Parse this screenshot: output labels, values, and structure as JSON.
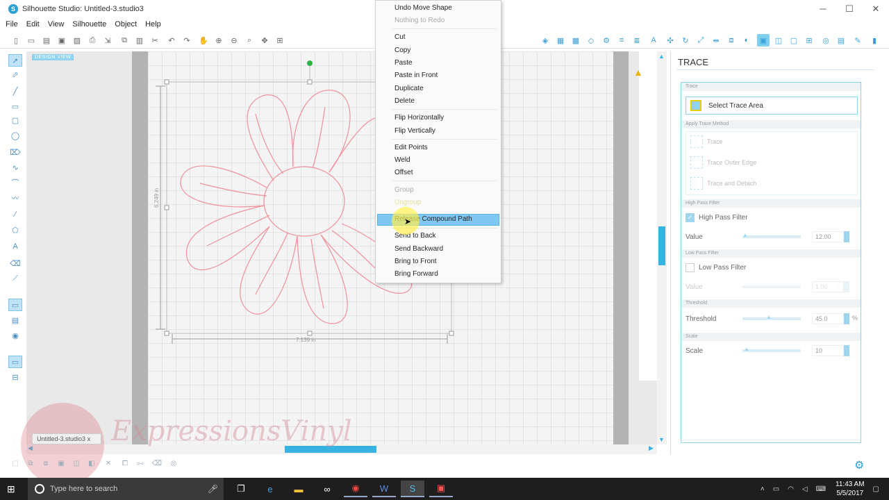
{
  "window": {
    "title": "Silhouette Studio: Untitled-3.studio3",
    "app_icon_glyph": "S",
    "minimize": "─",
    "maximize": "☐",
    "close": "✕"
  },
  "menu": [
    "File",
    "Edit",
    "View",
    "Silhouette",
    "Object",
    "Help"
  ],
  "workspace": {
    "design_view_label": "DESIGN VIEW",
    "dim_width": "7.139 in",
    "dim_height": "6.249 in",
    "doc_tab": "Untitled-3.studio3",
    "doc_tab_close": "x",
    "watermark_text": "ExpressionsVinyl"
  },
  "context_menu": {
    "items": [
      {
        "label": "Undo Move Shape",
        "enabled": true
      },
      {
        "label": "Nothing to Redo",
        "enabled": false
      },
      {
        "label": "Cut",
        "enabled": true
      },
      {
        "label": "Copy",
        "enabled": true
      },
      {
        "label": "Paste",
        "enabled": true
      },
      {
        "label": "Paste in Front",
        "enabled": true
      },
      {
        "label": "Duplicate",
        "enabled": true
      },
      {
        "label": "Delete",
        "enabled": true
      },
      {
        "label": "Flip Horizontally",
        "enabled": true
      },
      {
        "label": "Flip Vertically",
        "enabled": true
      },
      {
        "label": "Edit Points",
        "enabled": true
      },
      {
        "label": "Weld",
        "enabled": true
      },
      {
        "label": "Offset",
        "enabled": true
      },
      {
        "label": "Group",
        "enabled": false
      },
      {
        "label": "Ungroup",
        "enabled": false
      },
      {
        "label": "Release Compound Path",
        "enabled": true,
        "highlighted": true
      },
      {
        "label": "Send to Back",
        "enabled": true
      },
      {
        "label": "Send Backward",
        "enabled": true
      },
      {
        "label": "Bring to Front",
        "enabled": true
      },
      {
        "label": "Bring Forward",
        "enabled": true
      }
    ]
  },
  "trace_panel": {
    "title": "TRACE",
    "section_trace": "Trace",
    "select_trace_area": "Select Trace Area",
    "section_apply": "Apply Trace Method",
    "method_trace": "Trace",
    "method_outer": "Trace Outer Edge",
    "method_detach": "Trace and Detach",
    "section_high_pass": "High Pass Filter",
    "high_pass_label": "High Pass Filter",
    "high_pass_checked": true,
    "high_pass_value_label": "Value",
    "high_pass_value": "12.00",
    "section_low_pass": "Low Pass Filter",
    "low_pass_label": "Low Pass Filter",
    "low_pass_checked": false,
    "low_pass_value_label": "Value",
    "low_pass_value": "1.00",
    "section_threshold": "Threshold",
    "threshold_label": "Threshold",
    "threshold_value": "45.0",
    "threshold_unit": "%",
    "section_scale": "Scale",
    "scale_label": "Scale",
    "scale_value": "10"
  },
  "taskbar": {
    "search_placeholder": "Type here to search",
    "time": "11:43 AM",
    "date": "5/5/2017"
  },
  "colors": {
    "accent": "#38b2e0",
    "shape_stroke": "#f08f9a",
    "menu_highlight": "#7fc8f3"
  }
}
